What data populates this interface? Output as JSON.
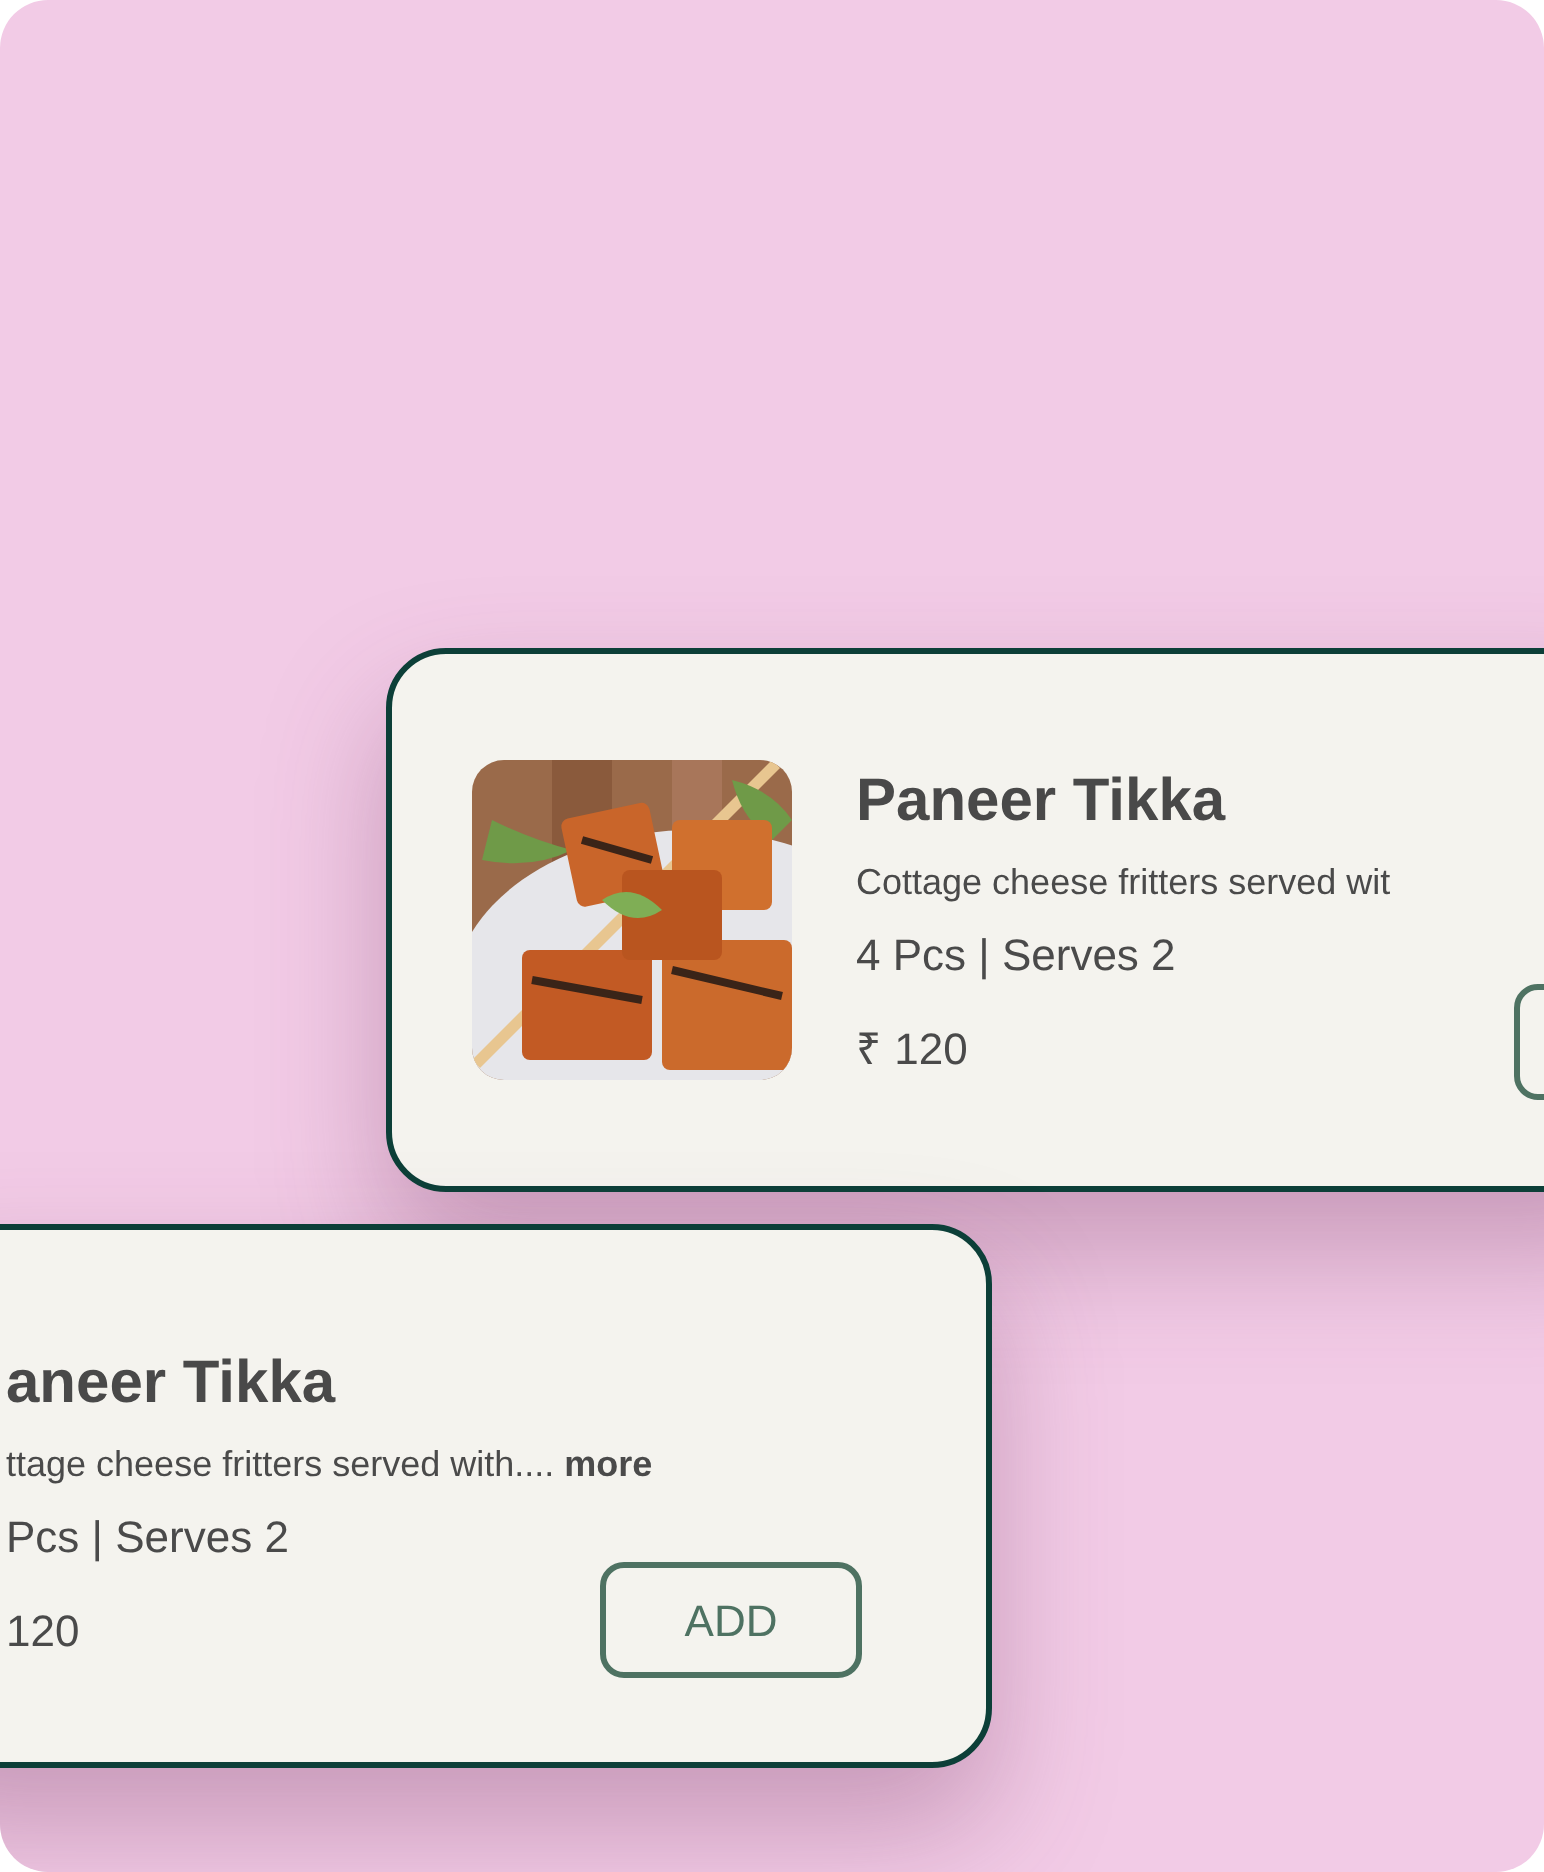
{
  "cards": [
    {
      "kind": "with_image",
      "title": "Paneer Tikka",
      "description": "Cottage cheese fritters served wit",
      "portion": "4 Pcs | Serves 2",
      "price": "₹ 120",
      "button_edge": true
    },
    {
      "kind": "cut_left",
      "title": "aneer Tikka",
      "description": "ttage cheese fritters served with.... **more**",
      "portion": "Pcs | Serves 2",
      "price": "120",
      "button": "ADD"
    }
  ]
}
